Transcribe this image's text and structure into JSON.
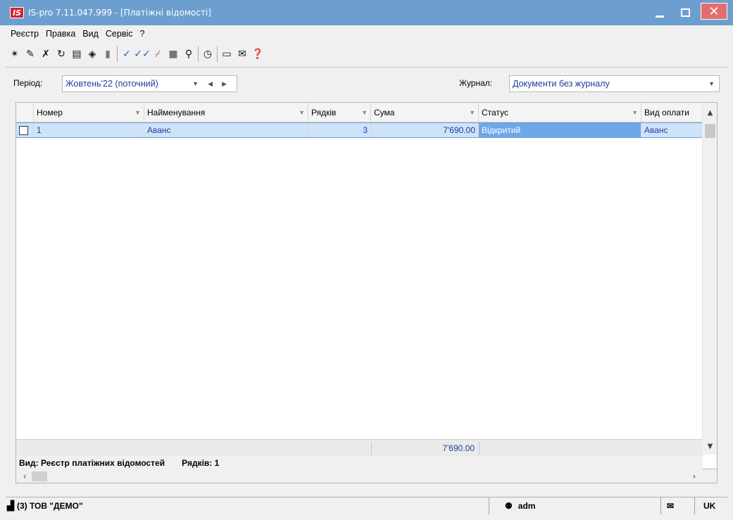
{
  "window": {
    "logo": "IS",
    "title": "IS-pro 7.11.047.999 - [Платіжні відомості]"
  },
  "menu": [
    "Реєстр",
    "Правка",
    "Вид",
    "Сервіс",
    "?"
  ],
  "toolbar_icons": [
    "create-icon",
    "create-copy-icon",
    "delete-icon",
    "refresh-icon",
    "print-icon",
    "package-icon",
    "bookmark-icon",
    "check-icon",
    "double-check-icon",
    "uncheck-icon",
    "block-icon",
    "search-icon",
    "clock-icon",
    "window-icon",
    "mail-icon",
    "help-icon"
  ],
  "filters": {
    "period_label": "Період:",
    "period_value": "Жовтень'22 (поточний)",
    "journal_label": "Журнал:",
    "journal_value": "Документи без журналу"
  },
  "table": {
    "columns": [
      "Номер",
      "Найменування",
      "Рядків",
      "Сума",
      "Статус",
      "Вид оплати"
    ],
    "rows": [
      {
        "number": "1",
        "name": "Аванс",
        "rows": "3",
        "sum": "7'690.00",
        "status": "Відкритий",
        "payment_type": "Аванс"
      }
    ],
    "total_sum": "7'690.00"
  },
  "view_info": {
    "view": "Вид: Реєстр платіжних відомостей",
    "rows": "Рядків: 1"
  },
  "statusbar": {
    "company": "(3) ТОВ \"ДЕМО\"",
    "user": "adm",
    "lang": "UK"
  },
  "colors": {
    "titlebar": "#6c9fcf",
    "selected_row": "#cfe3f8",
    "status_highlight": "#6fa7e8",
    "text_blue": "#1a3e9b"
  }
}
